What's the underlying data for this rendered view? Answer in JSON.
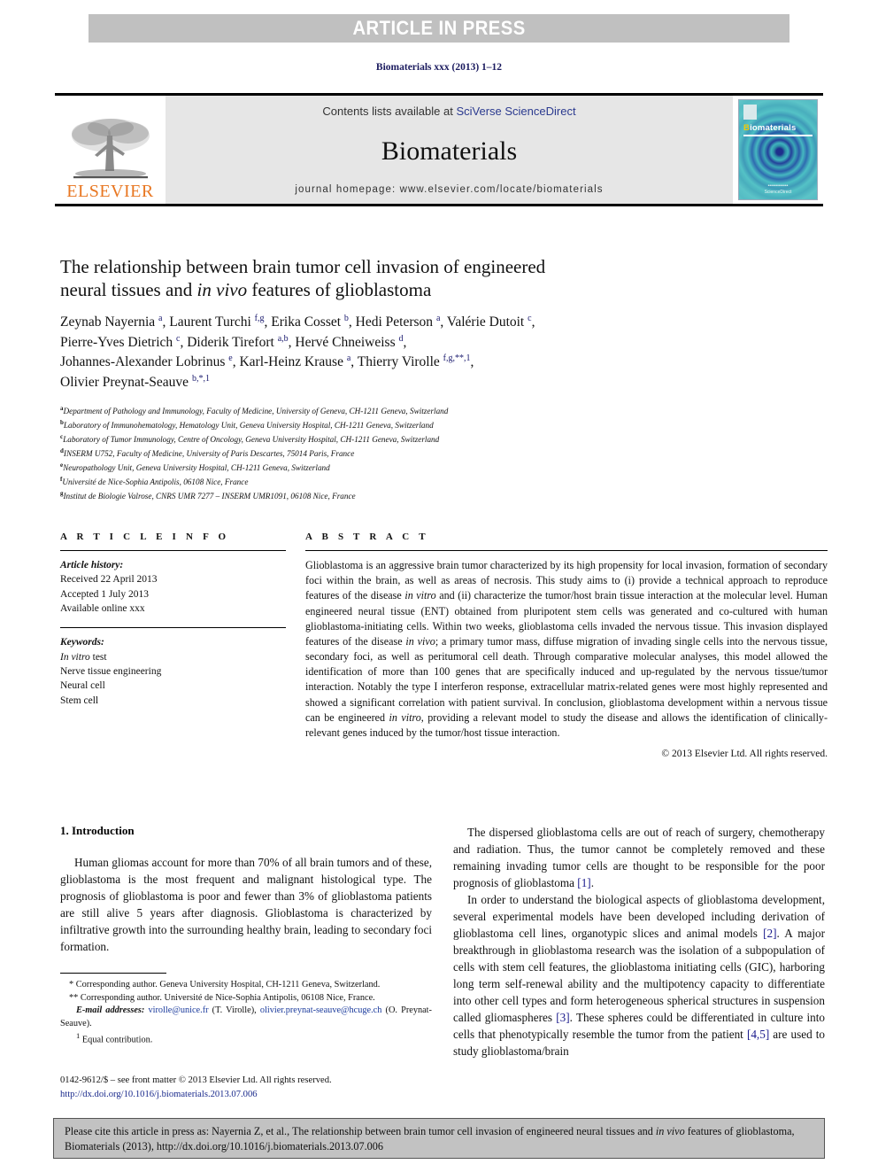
{
  "banner": {
    "text": "ARTICLE IN PRESS"
  },
  "running_head": "Biomaterials xxx (2013) 1–12",
  "masthead": {
    "contents_prefix": "Contents lists available at ",
    "sciencedirect_link": "SciVerse ScienceDirect",
    "journal_name": "Biomaterials",
    "homepage": "journal homepage: www.elsevier.com/locate/biomaterials",
    "publisher_logo_text": "ELSEVIER",
    "cover": {
      "title_first": "B",
      "title_rest": "iomaterials",
      "footer_line1": "•••••••••••••",
      "footer_line2": "ScienceDirect"
    }
  },
  "article": {
    "title_line1": "The relationship between brain tumor cell invasion of engineered",
    "title_line2_a": "neural tissues and ",
    "title_line2_italic": "in vivo",
    "title_line2_b": " features of glioblastoma",
    "authors": "Zeynab Nayernia a, Laurent Turchi f,g, Erika Cosset b, Hedi Peterson a, Valérie Dutoit c, Pierre-Yves Dietrich c, Diderik Tirefort a,b, Hervé Chneiweiss d, Johannes-Alexander Lobrinus e, Karl-Heinz Krause a, Thierry Virolle f,g,**,1, Olivier Preynat-Seauve b,*,1",
    "affiliations": [
      {
        "mark": "a",
        "text": "Department of Pathology and Immunology, Faculty of Medicine, University of Geneva, CH-1211 Geneva, Switzerland"
      },
      {
        "mark": "b",
        "text": "Laboratory of Immunohematology, Hematology Unit, Geneva University Hospital, CH-1211 Geneva, Switzerland"
      },
      {
        "mark": "c",
        "text": "Laboratory of Tumor Immunology, Centre of Oncology, Geneva University Hospital, CH-1211 Geneva, Switzerland"
      },
      {
        "mark": "d",
        "text": "INSERM U752, Faculty of Medicine, University of Paris Descartes, 75014 Paris, France"
      },
      {
        "mark": "e",
        "text": "Neuropathology Unit, Geneva University Hospital, CH-1211 Geneva, Switzerland"
      },
      {
        "mark": "f",
        "text": "Université de Nice-Sophia Antipolis, 06108 Nice, France"
      },
      {
        "mark": "g",
        "text": "Institut de Biologie Valrose, CNRS UMR 7277 – INSERM UMR1091, 06108 Nice, France"
      }
    ]
  },
  "article_info": {
    "heading": "A R T I C L E  I N F O",
    "history_label": "Article history:",
    "history": [
      "Received 22 April 2013",
      "Accepted 1 July 2013",
      "Available online xxx"
    ],
    "keywords_label": "Keywords:",
    "keywords_first_italic": "In vitro",
    "keywords_first_rest": " test",
    "keywords_rest": [
      "Nerve tissue engineering",
      "Neural cell",
      "Stem cell"
    ]
  },
  "abstract": {
    "heading": "A B S T R A C T",
    "p1": "Glioblastoma is an aggressive brain tumor characterized by its high propensity for local invasion, formation of secondary foci within the brain, as well as areas of necrosis. This study aims to (i) provide a technical approach to reproduce features of the disease ",
    "p1_i1": "in vitro",
    "p2": " and (ii) characterize the tumor/host brain tissue interaction at the molecular level. Human engineered neural tissue (ENT) obtained from pluripotent stem cells was generated and co-cultured with human glioblastoma-initiating cells. Within two weeks, glioblastoma cells invaded the nervous tissue. This invasion displayed features of the disease ",
    "p2_i2": "in vivo",
    "p3": "; a primary tumor mass, diffuse migration of invading single cells into the nervous tissue, secondary foci, as well as peritumoral cell death. Through comparative molecular analyses, this model allowed the identification of more than 100 genes that are specifically induced and up-regulated by the nervous tissue/tumor interaction. Notably the type I interferon response, extracellular matrix-related genes were most highly represented and showed a significant correlation with patient survival. In conclusion, glioblastoma development within a nervous tissue can be engineered ",
    "p3_i3": "in vitro",
    "p4": ", providing a relevant model to study the disease and allows the identification of clinically-relevant genes induced by the tumor/host tissue interaction.",
    "copyright": "© 2013 Elsevier Ltd. All rights reserved."
  },
  "body": {
    "section_heading": "1. Introduction",
    "left_p1": "Human gliomas account for more than 70% of all brain tumors and of these, glioblastoma is the most frequent and malignant histological type. The prognosis of glioblastoma is poor and fewer than 3% of glioblastoma patients are still alive 5 years after diagnosis. Glioblastoma is characterized by infiltrative growth into the surrounding healthy brain, leading to secondary foci formation.",
    "right_p1_a": "The dispersed glioblastoma cells are out of reach of surgery, chemotherapy and radiation. Thus, the tumor cannot be completely removed and these remaining invading tumor cells are thought to be responsible for the poor prognosis of glioblastoma ",
    "right_p1_ref": "[1]",
    "right_p1_b": ".",
    "right_p2_a": "In order to understand the biological aspects of glioblastoma development, several experimental models have been developed including derivation of glioblastoma cell lines, organotypic slices and animal models ",
    "right_p2_ref1": "[2]",
    "right_p2_b": ". A major breakthrough in glioblastoma research was the isolation of a subpopulation of cells with stem cell features, the glioblastoma initiating cells (GIC), harboring long term self-renewal ability and the multipotency capacity to differentiate into other cell types and form heterogeneous spherical structures in suspension called gliomaspheres ",
    "right_p2_ref2": "[3]",
    "right_p2_c": ". These spheres could be differentiated in culture into cells that phenotypically resemble the tumor from the patient ",
    "right_p2_ref3": "[4,5]",
    "right_p2_d": " are used to study glioblastoma/brain"
  },
  "footnotes": {
    "star1": "* Corresponding author. Geneva University Hospital, CH-1211 Geneva, Switzerland.",
    "star2": "** Corresponding author. Université de Nice-Sophia Antipolis, 06108 Nice, France.",
    "email_label": "E-mail addresses:",
    "email1": "virolle@unice.fr",
    "email1_owner": " (T. Virolle), ",
    "email2": "olivier.preynat-seauve@hcuge.ch",
    "email2_owner": " (O. Preynat-Seauve).",
    "equal": "1  Equal contribution."
  },
  "issn": {
    "line1": "0142-9612/$ – see front matter © 2013 Elsevier Ltd. All rights reserved.",
    "doi": "http://dx.doi.org/10.1016/j.biomaterials.2013.07.006"
  },
  "cite_box": {
    "text_a": "Please cite this article in press as: Nayernia Z, et al., The relationship between brain tumor cell invasion of engineered neural tissues and ",
    "text_italic": "in vivo",
    "text_b": " features of glioblastoma, Biomaterials (2013), http://dx.doi.org/10.1016/j.biomaterials.2013.07.006"
  },
  "colors": {
    "banner_bg": "#c0c0c0",
    "link_blue": "#2b3a8f",
    "elsevier_orange": "#E87722",
    "masthead_bg": "#e6e6e6",
    "cite_box_bg": "#c2c2c2"
  }
}
